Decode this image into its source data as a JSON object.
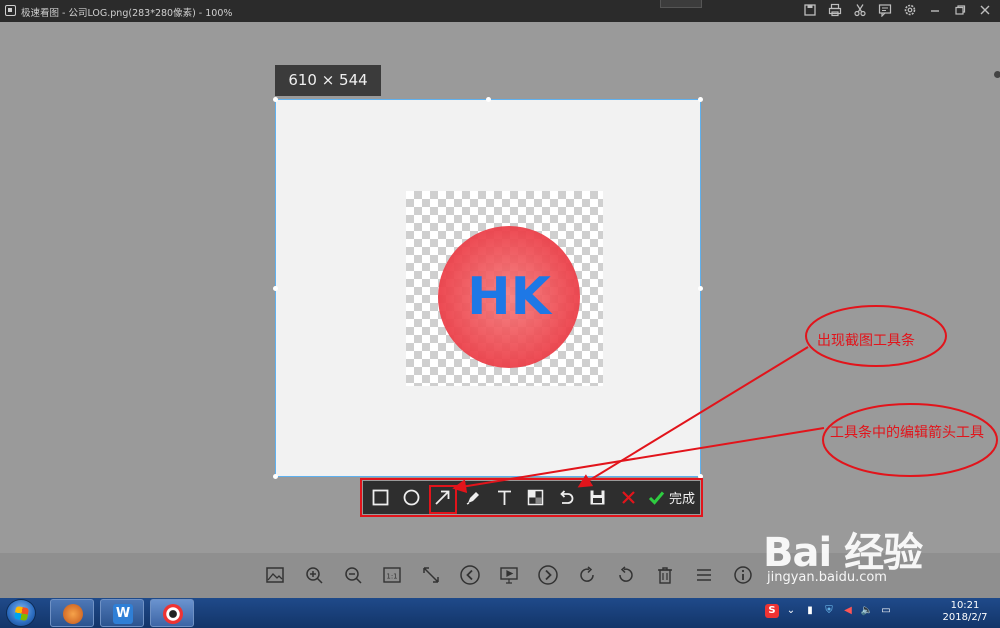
{
  "titlebar": {
    "title": "极速看图 - 公司LOG.png(283*280像素) - 100%",
    "icons": [
      "save-icon",
      "print-icon",
      "scissors-icon",
      "comment-icon",
      "settings-icon",
      "minimize-icon",
      "restore-icon",
      "close-icon"
    ]
  },
  "capture": {
    "size_label": "610 × 544",
    "logo_text": "HK"
  },
  "capture_toolbar": {
    "tools": [
      "rectangle-icon",
      "ellipse-icon",
      "arrow-icon",
      "pen-icon",
      "text-icon",
      "mosaic-icon",
      "undo-icon",
      "save-icon",
      "cancel-icon"
    ],
    "selected_tool": "arrow-icon",
    "done_label": "完成",
    "colors": {
      "accent_red": "#e2141b",
      "done_green": "#2ecc40"
    }
  },
  "annotations": {
    "callout1": "出现截图工具条",
    "callout2": "工具条中的编辑箭头工具"
  },
  "viewer_toolbar": {
    "icons": [
      "image-icon",
      "zoom-in-icon",
      "zoom-out-icon",
      "actual-size-icon",
      "fit-screen-icon",
      "prev-icon",
      "slideshow-icon",
      "next-icon",
      "rotate-right-icon",
      "rotate-left-icon",
      "delete-icon",
      "menu-icon",
      "info-icon"
    ],
    "actual_size_label": "1:1"
  },
  "taskbar": {
    "time": "10:21",
    "date": "2018/2/7",
    "ime_label": "S"
  },
  "watermark": {
    "brand": "Bai  经验",
    "url": "jingyan.baidu.com"
  }
}
